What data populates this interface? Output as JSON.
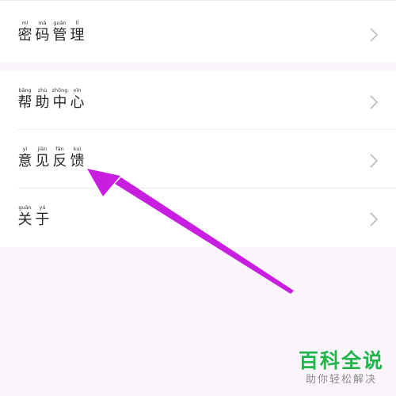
{
  "menu": {
    "password_management": {
      "chars": [
        "密",
        "码",
        "管",
        "理"
      ],
      "pinyin": [
        "mì",
        "mǎ",
        "guǎn",
        "lǐ"
      ],
      "chevron_icon": "chevron-right-icon"
    },
    "help_center": {
      "chars": [
        "帮",
        "助",
        "中",
        "心"
      ],
      "pinyin": [
        "bāng",
        "zhù",
        "zhōng",
        "xīn"
      ],
      "chevron_icon": "chevron-right-icon"
    },
    "feedback": {
      "chars": [
        "意",
        "见",
        "反",
        "馈"
      ],
      "pinyin": [
        "yì",
        "jiàn",
        "fǎn",
        "kuì"
      ],
      "chevron_icon": "chevron-right-icon"
    },
    "about": {
      "chars": [
        "关",
        "于"
      ],
      "pinyin": [
        "guān",
        "yú"
      ],
      "chevron_icon": "chevron-right-icon"
    }
  },
  "annotation": {
    "arrow_color": "#c81ee0",
    "points_to": "feedback"
  },
  "watermark": {
    "title": "百科全说",
    "subtitle": "助你轻松解决",
    "color": "#1fb54a"
  },
  "colors": {
    "background": "#faf5fa",
    "card": "#ffffff",
    "chevron": "#bbbbbb"
  }
}
